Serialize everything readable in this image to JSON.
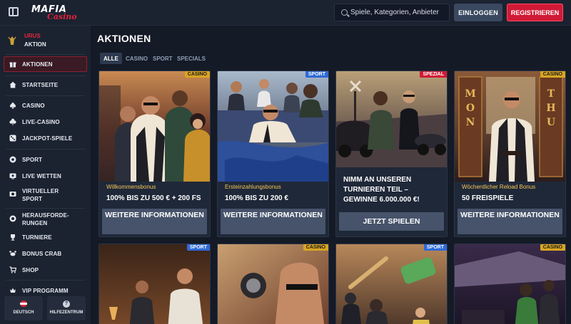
{
  "header": {
    "logo_line1": "MAFIA",
    "logo_line2": "Casino",
    "search_placeholder": "Spiele, Kategorien, Anbieter",
    "login_label": "EINLOGGEN",
    "register_label": "REGISTRIEREN"
  },
  "sidebar": {
    "promo": {
      "line1": "URUS",
      "line2": "AKTION"
    },
    "items": [
      {
        "label": "AKTIONEN",
        "icon": "gift-icon"
      },
      {
        "label": "STARTSEITE",
        "icon": "home-icon"
      },
      {
        "label": "CASINO",
        "icon": "spade-icon"
      },
      {
        "label": "LIVE-CASINO",
        "icon": "clover-icon"
      },
      {
        "label": "JACKPOT-SPIELE",
        "icon": "dice-icon"
      },
      {
        "label": "SPORT",
        "icon": "soccer-ball-icon"
      },
      {
        "label": "LIVE WETTEN",
        "icon": "live-bet-icon"
      },
      {
        "label": "VIRTUELLER SPORT",
        "icon": "virtual-sport-icon"
      },
      {
        "label": "HERAUSFORDE-RUNGEN",
        "icon": "challenge-icon"
      },
      {
        "label": "TURNIERE",
        "icon": "trophy-icon"
      },
      {
        "label": "BONUS CRAB",
        "icon": "crab-icon"
      },
      {
        "label": "SHOP",
        "icon": "cart-icon"
      },
      {
        "label": "VIP PROGRAMM",
        "icon": "vip-icon"
      }
    ],
    "language_label": "DEUTSCH",
    "help_label": "HILFEZENTRUM"
  },
  "main": {
    "title": "AKTIONEN",
    "filters": [
      "ALLE",
      "CASINO",
      "SPORT",
      "SPECIALS"
    ],
    "active_filter": "ALLE",
    "cards": [
      {
        "badge": "CASINO",
        "subtitle": "Willkommensbonus",
        "title": "100% BIS ZU 500 € + 200 FS",
        "button": "WEITERE INFORMATIONEN"
      },
      {
        "badge": "SPORT",
        "subtitle": "Ersteinzahlungsbonus",
        "title": "100% BIS ZU 200 €",
        "button": "WEITERE INFORMATIONEN"
      },
      {
        "badge": "SPEZIAL",
        "subtitle": "",
        "title": "NIMM AN UNSEREN TURNIEREN TEIL – GEWINNE 6.000.000 €!",
        "button": "JETZT SPIELEN"
      },
      {
        "badge": "CASINO",
        "subtitle": "Wöchentlicher Reload Bonus",
        "title": "50 FREISPIELE",
        "button": "WEITERE INFORMATIONEN"
      },
      {
        "badge": "SPORT"
      },
      {
        "badge": "CASINO"
      },
      {
        "badge": "SPORT"
      },
      {
        "badge": "CASINO"
      }
    ],
    "card4_sign_left": "MON",
    "card4_sign_right": "THU"
  },
  "colors": {
    "accent_red": "#d11a35",
    "casino_badge": "#d9a522",
    "sport_badge": "#2f6ad6",
    "bonus_subtitle": "#f3c65a"
  }
}
